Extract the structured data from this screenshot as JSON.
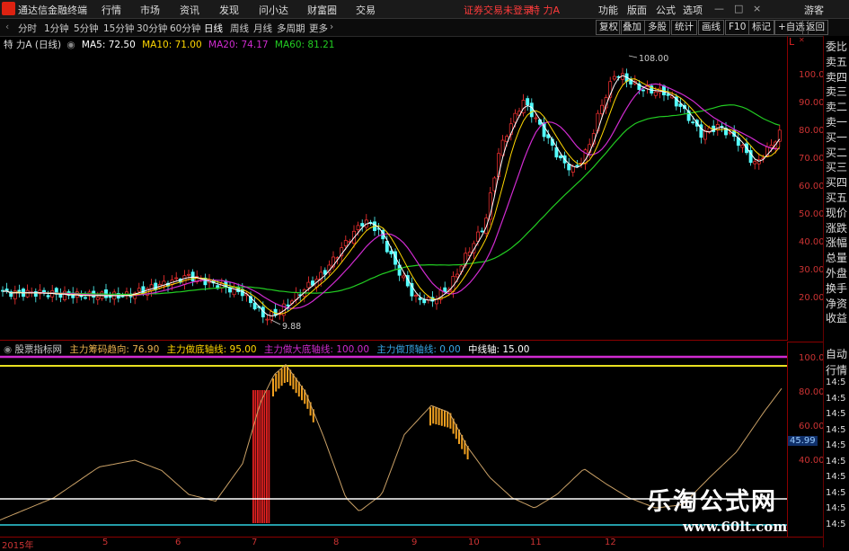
{
  "app": {
    "brand": "通达信金融终端",
    "warning": "证券交易未登录",
    "stock_name": "特 力A",
    "guest": "游客"
  },
  "menu": [
    {
      "label": "行情"
    },
    {
      "label": "市场"
    },
    {
      "label": "资讯"
    },
    {
      "label": "发现"
    },
    {
      "label": "问小达"
    },
    {
      "label": "财富圈"
    },
    {
      "label": "交易"
    }
  ],
  "topright_menu": [
    {
      "label": "功能"
    },
    {
      "label": "版面"
    },
    {
      "label": "公式"
    },
    {
      "label": "选项"
    }
  ],
  "periods": [
    {
      "label": "分时"
    },
    {
      "label": "1分钟"
    },
    {
      "label": "5分钟"
    },
    {
      "label": "15分钟"
    },
    {
      "label": "30分钟"
    },
    {
      "label": "60分钟"
    },
    {
      "label": "日线"
    },
    {
      "label": "周线"
    },
    {
      "label": "月线"
    },
    {
      "label": "多周期"
    },
    {
      "label": "更多"
    }
  ],
  "toolbar_right": [
    {
      "label": "复权"
    },
    {
      "label": "叠加"
    },
    {
      "label": "多股"
    },
    {
      "label": "统计"
    },
    {
      "label": "画线"
    },
    {
      "label": "F10"
    },
    {
      "label": "标记"
    },
    {
      "label": "+自选"
    },
    {
      "label": "返回"
    }
  ],
  "main_legend": {
    "title": "特 力A (日线)",
    "ma5": "MA5: 72.50",
    "ma10": "MA10: 71.00",
    "ma20": "MA20: 74.17",
    "ma60": "MA60: 81.21",
    "colors": {
      "ma5": "#ffffff",
      "ma10": "#ffd700",
      "ma20": "#d02bd0",
      "ma60": "#22cc22"
    }
  },
  "annotations": {
    "high": "108.00",
    "low": "9.88"
  },
  "main_axis": [
    "100.0",
    "90.00",
    "80.00",
    "70.00",
    "60.00",
    "50.00",
    "40.00",
    "30.00",
    "20.00"
  ],
  "sub_legend": {
    "name": "股票指标网",
    "l1": "主力筹码趋向: 76.90",
    "l2": "主力做底轴线: 95.00",
    "l3": "主力做大底轴线: 100.00",
    "l4": "主力做顶轴线: 0.00",
    "l5": "中线轴: 15.00"
  },
  "sub_axis": [
    "100.0",
    "80.00",
    "60.00",
    "40.00"
  ],
  "sub_value_badge": "45.99",
  "x_axis": [
    "2015年",
    "5",
    "6",
    "7",
    "8",
    "9",
    "10",
    "11",
    "12"
  ],
  "right_panel": [
    "委比",
    "卖五",
    "卖四",
    "卖三",
    "卖二",
    "卖一",
    "买一",
    "买二",
    "买三",
    "买四",
    "买五",
    "现价",
    "涨跌",
    "涨幅",
    "总量",
    "外盘",
    "换手",
    "净资",
    "收益"
  ],
  "right_panel_bottom": [
    "自动",
    "行情",
    "14:5",
    "14:5",
    "14:5",
    "14:5",
    "14:5",
    "14:5",
    "14:5",
    "14:5",
    "14:5",
    "14:5"
  ],
  "watermark": {
    "name": "乐淘公式网",
    "url": "www.60lt.com"
  }
}
